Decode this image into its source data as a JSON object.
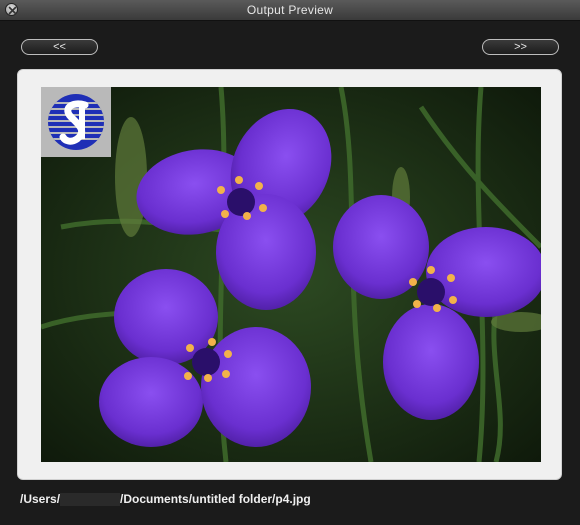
{
  "window": {
    "title": "Output Preview"
  },
  "nav": {
    "prev_label": "<<",
    "next_label": ">>"
  },
  "path": {
    "prefix": "/Users/",
    "suffix": "/Documents/untitled folder/p4.jpg"
  },
  "image": {
    "subject": "purple three-petal flowers"
  },
  "colors": {
    "accent_purple": "#6a2fd0",
    "logo_blue": "#1f2fb6"
  }
}
